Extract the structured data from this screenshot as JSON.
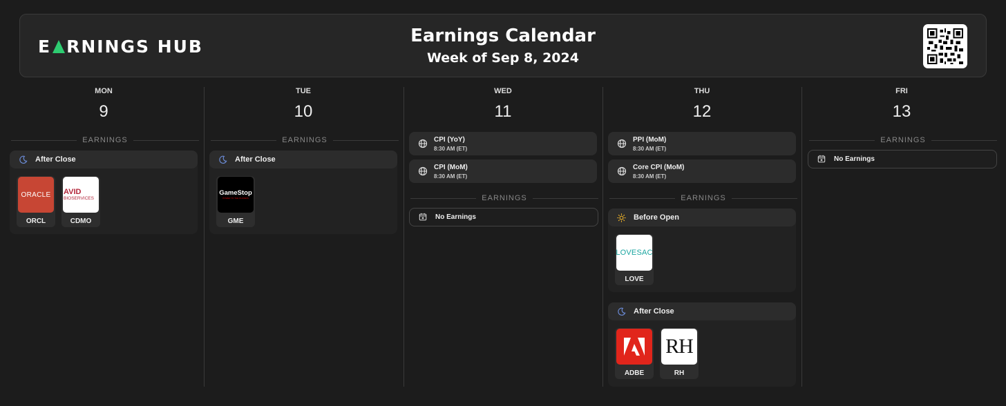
{
  "header": {
    "logo_text_1": "E",
    "logo_text_2": "RNINGS HUB",
    "title": "Earnings Calendar",
    "subtitle": "Week of Sep 8, 2024"
  },
  "colors": {
    "accent": "#2ecc71",
    "moon": "#6b8bd6",
    "sun": "#f0b429",
    "background": "#1c1c1c"
  },
  "section_label": "EARNINGS",
  "days": [
    {
      "dow": "MON",
      "num": "9",
      "after_close": {
        "label": "After Close",
        "icon": "moon-icon",
        "tickers": [
          {
            "ticker": "ORCL",
            "logo_text": "ORACLE"
          },
          {
            "ticker": "CDMO",
            "logo_text_1": "AVID",
            "logo_text_2": "BIOSERVICES"
          }
        ]
      }
    },
    {
      "dow": "TUE",
      "num": "10",
      "after_close": {
        "label": "After Close",
        "icon": "moon-icon",
        "tickers": [
          {
            "ticker": "GME",
            "logo_text": "GameStop",
            "logo_sub": "POWER TO THE PLAYERS"
          }
        ]
      }
    },
    {
      "dow": "WED",
      "num": "11",
      "events": [
        {
          "name": "CPI (YoY)",
          "time": "8:30 AM (ET)",
          "icon": "globe-icon"
        },
        {
          "name": "CPI (MoM)",
          "time": "8:30 AM (ET)",
          "icon": "globe-icon"
        }
      ],
      "no_earnings": "No Earnings"
    },
    {
      "dow": "THU",
      "num": "12",
      "events": [
        {
          "name": "PPI (MoM)",
          "time": "8:30 AM (ET)",
          "icon": "globe-icon"
        },
        {
          "name": "Core CPI (MoM)",
          "time": "8:30 AM (ET)",
          "icon": "globe-icon"
        }
      ],
      "before_open": {
        "label": "Before Open",
        "icon": "sun-icon",
        "tickers": [
          {
            "ticker": "LOVE",
            "logo_text": "LOVESAC"
          }
        ]
      },
      "after_close": {
        "label": "After Close",
        "icon": "moon-icon",
        "tickers": [
          {
            "ticker": "ADBE",
            "logo_text": "A"
          },
          {
            "ticker": "RH",
            "logo_text": "RH"
          }
        ]
      }
    },
    {
      "dow": "FRI",
      "num": "13",
      "no_earnings": "No Earnings"
    }
  ]
}
